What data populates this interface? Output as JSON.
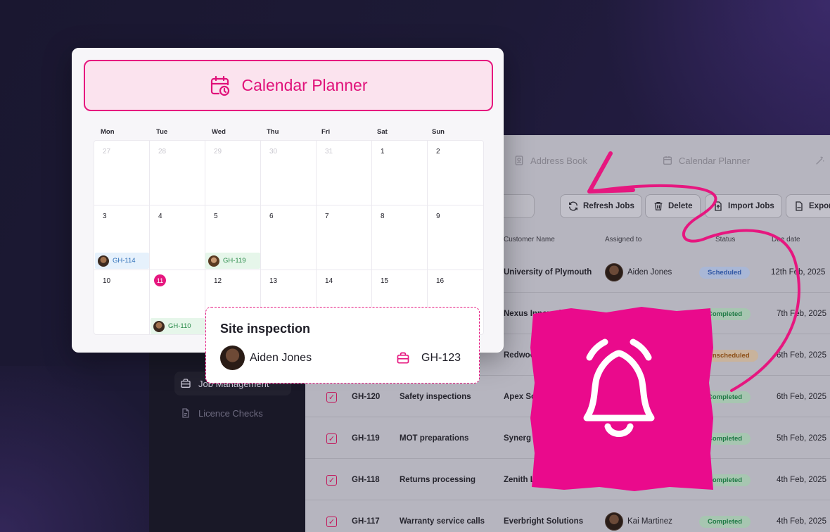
{
  "calendar": {
    "title": "Calendar Planner",
    "weekdays": [
      "Mon",
      "Tue",
      "Wed",
      "Thu",
      "Fri",
      "Sat",
      "Sun"
    ],
    "week1": [
      "27",
      "28",
      "29",
      "30",
      "31",
      "1",
      "2"
    ],
    "week2": [
      "3",
      "4",
      "5",
      "6",
      "7",
      "8",
      "9"
    ],
    "week3": [
      "10",
      "11",
      "12",
      "13",
      "14",
      "15",
      "16"
    ],
    "events": {
      "gh114": "GH-114",
      "gh119": "GH-119",
      "gh110": "GH-110"
    },
    "accent": "#e6177f"
  },
  "tooltip": {
    "title": "Site inspection",
    "assignee": "Aiden Jones",
    "job_code": "GH-123"
  },
  "sidebar": {
    "items": [
      {
        "label": "Job Management",
        "icon": "briefcase-icon"
      },
      {
        "label": "Licence Checks",
        "icon": "document-icon"
      }
    ]
  },
  "topnav": {
    "address_book": "Address Book",
    "calendar_planner": "Calendar Planner"
  },
  "toolbar": {
    "refresh": "Refresh Jobs",
    "delete": "Delete",
    "import": "Import Jobs",
    "export": "Expor"
  },
  "table": {
    "headers": {
      "customer": "Customer Name",
      "assigned": "Assigned to",
      "status": "Status",
      "due": "Due date"
    },
    "rows": [
      {
        "customer": "University of Plymouth",
        "assigned": "Aiden Jones",
        "status": "Scheduled",
        "due": "12th Feb, 2025"
      },
      {
        "customer": "Nexus Innovations",
        "status": "Completed",
        "due": "7th Feb, 2025"
      },
      {
        "customer": "Redwoo",
        "status": "Unscheduled",
        "due": "6th Feb, 2025"
      },
      {
        "id": "GH-120",
        "desc": "Safety inspections",
        "customer": "Apex So",
        "status": "Completed",
        "due": "6th Feb, 2025"
      },
      {
        "id": "GH-119",
        "desc": "MOT preparations",
        "customer": "Synerg",
        "status": "Completed",
        "due": "5th Feb, 2025"
      },
      {
        "id": "GH-118",
        "desc": "Returns processing",
        "customer": "Zenith Labs",
        "status": "Completed",
        "due": "4th Feb, 2025"
      },
      {
        "id": "GH-117",
        "desc": "Warranty service calls",
        "customer": "Everbright Solutions",
        "assigned": "Kai Martinez",
        "status": "Completed",
        "due": "4th Feb, 2025"
      }
    ]
  },
  "notification": {
    "icon": "bell-icon",
    "color": "#ea0a8c"
  }
}
